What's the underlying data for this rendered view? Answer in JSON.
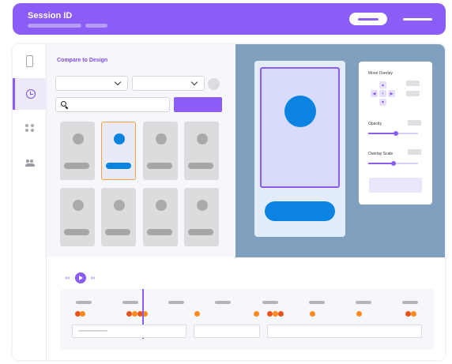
{
  "header": {
    "title": "Session ID"
  },
  "sidebar": {
    "items": [
      {
        "id": "device",
        "icon": "phone-icon",
        "active": false
      },
      {
        "id": "history",
        "icon": "clock-icon",
        "active": true
      },
      {
        "id": "components",
        "icon": "grid-icon",
        "active": false
      },
      {
        "id": "team",
        "icon": "users-icon",
        "active": false
      }
    ]
  },
  "compare": {
    "title": "Compare to Design",
    "selected_tile_index": 1
  },
  "overlay_panel": {
    "move_label": "Move Overlay",
    "opacity_label": "Opacity",
    "opacity_value_fraction": 0.55,
    "scale_label": "Overlay Scale",
    "scale_value_fraction": 0.5
  },
  "colors": {
    "accent": "#8b5cf6",
    "brand_blue": "#0a84e0",
    "preview_bg": "#7fa0bf",
    "event_orange": "#ff8a1f",
    "event_red": "#e8541c"
  }
}
